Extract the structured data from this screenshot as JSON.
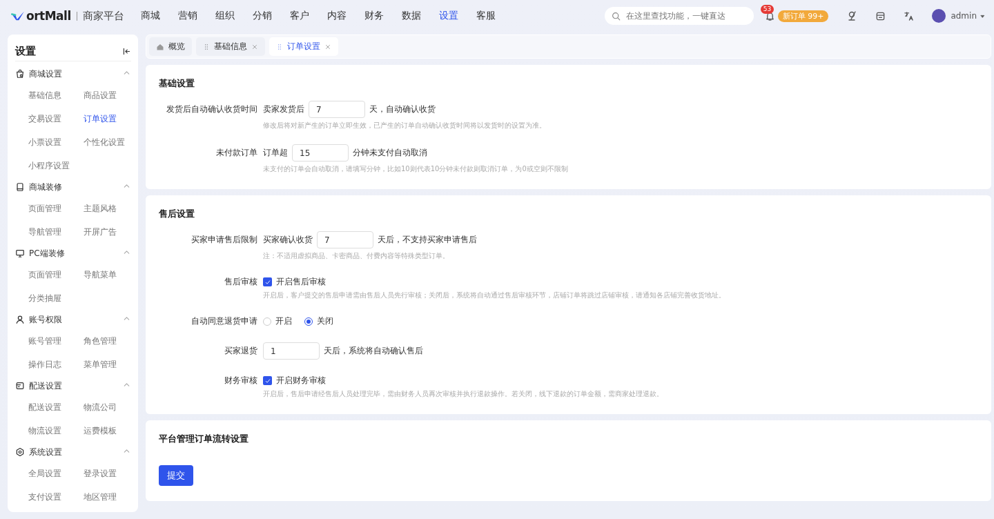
{
  "header": {
    "brand": "ortMall",
    "platform": "商家平台",
    "nav": [
      {
        "label": "商城",
        "selected": false
      },
      {
        "label": "营销",
        "selected": false
      },
      {
        "label": "组织",
        "selected": false
      },
      {
        "label": "分销",
        "selected": false
      },
      {
        "label": "客户",
        "selected": false
      },
      {
        "label": "内容",
        "selected": false
      },
      {
        "label": "财务",
        "selected": false
      },
      {
        "label": "数据",
        "selected": false
      },
      {
        "label": "设置",
        "selected": true
      },
      {
        "label": "客服",
        "selected": false
      }
    ],
    "search": {
      "placeholder": "在这里查找功能，一键直达"
    },
    "notification_count": "53",
    "order_badge": "新订单 99+",
    "user": "admin"
  },
  "sidebar": {
    "title": "设置",
    "groups": [
      {
        "title": "商城设置",
        "expanded": true,
        "items": [
          {
            "label": "基础信息",
            "selected": false
          },
          {
            "label": "商品设置",
            "selected": false
          },
          {
            "label": "交易设置",
            "selected": false
          },
          {
            "label": "订单设置",
            "selected": true
          },
          {
            "label": "小票设置",
            "selected": false
          },
          {
            "label": "个性化设置",
            "selected": false
          },
          {
            "label": "小程序设置",
            "selected": false
          }
        ]
      },
      {
        "title": "商城装修",
        "expanded": true,
        "items": [
          {
            "label": "页面管理",
            "selected": false
          },
          {
            "label": "主题风格",
            "selected": false
          },
          {
            "label": "导航管理",
            "selected": false
          },
          {
            "label": "开屏广告",
            "selected": false
          }
        ]
      },
      {
        "title": "PC端装修",
        "expanded": true,
        "items": [
          {
            "label": "页面管理",
            "selected": false
          },
          {
            "label": "导航菜单",
            "selected": false
          },
          {
            "label": "分类抽屉",
            "selected": false
          }
        ]
      },
      {
        "title": "账号权限",
        "expanded": true,
        "items": [
          {
            "label": "账号管理",
            "selected": false
          },
          {
            "label": "角色管理",
            "selected": false
          },
          {
            "label": "操作日志",
            "selected": false
          },
          {
            "label": "菜单管理",
            "selected": false
          }
        ]
      },
      {
        "title": "配送设置",
        "expanded": true,
        "items": [
          {
            "label": "配送设置",
            "selected": false
          },
          {
            "label": "物流公司",
            "selected": false
          },
          {
            "label": "物流设置",
            "selected": false
          },
          {
            "label": "运费模板",
            "selected": false
          }
        ]
      },
      {
        "title": "系统设置",
        "expanded": true,
        "items": [
          {
            "label": "全局设置",
            "selected": false
          },
          {
            "label": "登录设置",
            "selected": false
          },
          {
            "label": "支付设置",
            "selected": false
          },
          {
            "label": "地区管理",
            "selected": false
          }
        ]
      }
    ]
  },
  "tabs": [
    {
      "label": "概览",
      "kind": "home",
      "selected": false
    },
    {
      "label": "基础信息",
      "kind": "page",
      "selected": false
    },
    {
      "label": "订单设置",
      "kind": "page",
      "selected": true
    }
  ],
  "sections": [
    {
      "title": "基础设置",
      "rows": [
        {
          "kind": "input",
          "label": "发货后自动确认收货时间",
          "prefix": "卖家发货后",
          "value": "7",
          "suffix": "天，自动确认收货",
          "hint": "修改后将对新产生的订单立即生效，已产生的订单自动确认收货时间将以发货时的设置为准。"
        },
        {
          "kind": "input",
          "label": "未付款订单",
          "prefix": "订单超",
          "value": "15",
          "suffix": "分钟未支付自动取消",
          "hint": "未支付的订单会自动取消，请填写分钟，比如10则代表10分钟未付款则取消订单，为0或空则不限制"
        }
      ]
    },
    {
      "title": "售后设置",
      "rows": [
        {
          "kind": "input",
          "label": "买家申请售后限制",
          "prefix": "买家确认收货",
          "value": "7",
          "suffix": "天后，不支持买家申请售后",
          "hint": "注：不适用虚拟商品、卡密商品、付费内容等特殊类型订单。"
        },
        {
          "kind": "checkbox",
          "label": "售后审核",
          "checked": true,
          "text": "开启售后审核",
          "hint": "开启后，客户提交的售后申请需由售后人员先行审核；关闭后，系统将自动通过售后审核环节，店铺订单将跳过店铺审核，请通知各店铺完善收货地址。"
        },
        {
          "kind": "radio",
          "label": "自动同意退货申请",
          "options": [
            {
              "label": "开启",
              "selected": false
            },
            {
              "label": "关闭",
              "selected": true
            }
          ]
        },
        {
          "kind": "input",
          "label": "买家退货",
          "value": "1",
          "suffix": "天后，系统将自动确认售后"
        },
        {
          "kind": "checkbox",
          "label": "财务审核",
          "checked": true,
          "text": "开启财务审核",
          "hint": "开启后，售后申请经售后人员处理完毕，需由财务人员再次审核并执行退款操作。若关闭，线下退款的订单金额，需商家处理退款。"
        }
      ]
    },
    {
      "title": "平台管理订单流转设置"
    }
  ],
  "submit": "提交"
}
